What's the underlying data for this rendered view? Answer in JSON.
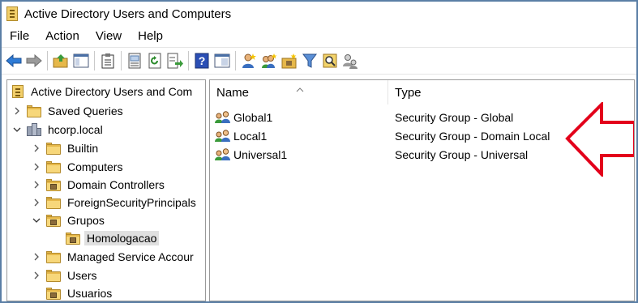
{
  "window": {
    "title": "Active Directory Users and Computers"
  },
  "menu": [
    "File",
    "Action",
    "View",
    "Help"
  ],
  "toolbar": {
    "icons": [
      "back-arrow-icon",
      "forward-arrow-icon",
      "up-folder-icon",
      "show-tree-icon",
      "clipboard-icon",
      "properties-icon",
      "refresh-icon",
      "export-list-icon",
      "help-icon",
      "console-tree-icon",
      "new-user-icon",
      "new-group-icon",
      "new-ou-icon",
      "filter-icon",
      "find-icon",
      "delegate-icon"
    ]
  },
  "tree": {
    "root": "Active Directory Users and Com",
    "items": [
      {
        "label": "Saved Queries",
        "icon": "folder-icon",
        "expanded": false
      },
      {
        "label": "hcorp.local",
        "icon": "domain-icon",
        "expanded": true
      },
      {
        "label": "Builtin",
        "icon": "folder-icon",
        "expanded": false
      },
      {
        "label": "Computers",
        "icon": "folder-icon",
        "expanded": false
      },
      {
        "label": "Domain Controllers",
        "icon": "ou-folder-icon",
        "expanded": false
      },
      {
        "label": "ForeignSecurityPrincipals",
        "icon": "folder-icon",
        "expanded": false
      },
      {
        "label": "Grupos",
        "icon": "ou-folder-icon",
        "expanded": true
      },
      {
        "label": "Homologacao",
        "icon": "ou-folder-icon",
        "selected": true
      },
      {
        "label": "Managed Service Accour",
        "icon": "folder-icon",
        "expanded": false
      },
      {
        "label": "Users",
        "icon": "folder-icon",
        "expanded": false
      },
      {
        "label": "Usuarios",
        "icon": "ou-folder-icon",
        "expanded": false
      }
    ]
  },
  "list": {
    "columns": [
      "Name",
      "Type"
    ],
    "rows": [
      {
        "name": "Global1",
        "type": "Security Group - Global"
      },
      {
        "name": "Local1",
        "type": "Security Group - Domain Local"
      },
      {
        "name": "Universal1",
        "type": "Security Group - Universal"
      }
    ]
  },
  "colors": {
    "frame_border": "#5b7fa6",
    "annotation_arrow": "#e3001b",
    "folder": "#e6b84a",
    "selection": "#e0e0e0"
  }
}
